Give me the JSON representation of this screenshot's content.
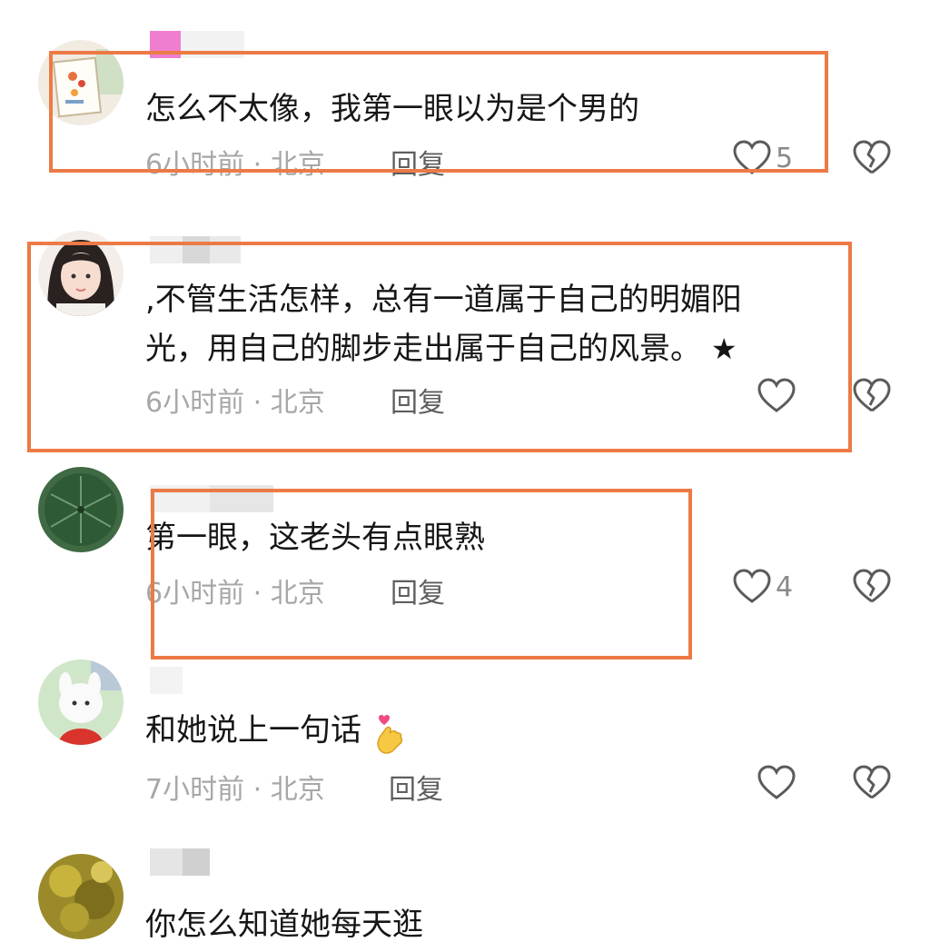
{
  "comments": [
    {
      "avatar": "photo-frame-avatar",
      "text": "怎么不太像，我第一眼以为是个男的",
      "time_location": "6小时前 · 北京",
      "reply": "回复",
      "likes": "5"
    },
    {
      "avatar": "portrait-avatar",
      "text_line1": ",不管生活怎样，总有一道属于自己的明媚阳",
      "text_line2": "光，用自己的脚步走出属于自己的风景。",
      "star": "★",
      "time_location": "6小时前 · 北京",
      "reply": "回复",
      "likes": ""
    },
    {
      "avatar": "umbrella-avatar",
      "text": "第一眼，这老头有点眼熟",
      "time_location": "6小时前 · 北京",
      "reply": "回复",
      "likes": "4"
    },
    {
      "avatar": "bunny-avatar",
      "text": "和她说上一句话",
      "emoji": "finger-heart-emoji",
      "time_location": "7小时前 · 北京",
      "reply": "回复",
      "likes": ""
    },
    {
      "avatar": "leaves-avatar",
      "text": "你怎么知道她每天逛"
    }
  ],
  "colors": {
    "highlight_box": "#ec7a45",
    "meta_text": "#a7a7a7",
    "reply_text": "#5e5e5e",
    "icon_stroke": "#5b5b5b"
  }
}
